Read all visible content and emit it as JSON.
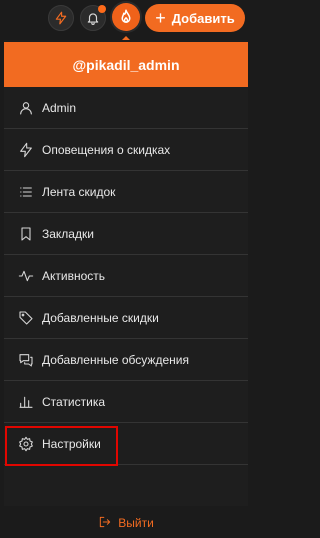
{
  "topbar": {
    "flash_icon": "flash-icon",
    "bell_icon": "bell-icon",
    "avatar_icon": "flame-icon",
    "add_button_label": "Добавить",
    "add_button_icon": "plus-icon"
  },
  "menu": {
    "username": "@pikadil_admin",
    "items": [
      {
        "label": "Admin",
        "icon": "user-icon"
      },
      {
        "label": "Оповещения о скидках",
        "icon": "flash-icon"
      },
      {
        "label": "Лента скидок",
        "icon": "list-icon"
      },
      {
        "label": "Закладки",
        "icon": "bookmark-icon"
      },
      {
        "label": "Активность",
        "icon": "activity-icon"
      },
      {
        "label": "Добавленные скидки",
        "icon": "tag-icon"
      },
      {
        "label": "Добавленные обсуждения",
        "icon": "chat-icon"
      },
      {
        "label": "Статистика",
        "icon": "bar-chart-icon"
      },
      {
        "label": "Настройки",
        "icon": "gear-icon"
      }
    ],
    "logout_label": "Выйти",
    "logout_icon": "logout-icon"
  },
  "colors": {
    "accent": "#f26b21",
    "background": "#1b1b1b",
    "highlight_box": "#e10600"
  }
}
